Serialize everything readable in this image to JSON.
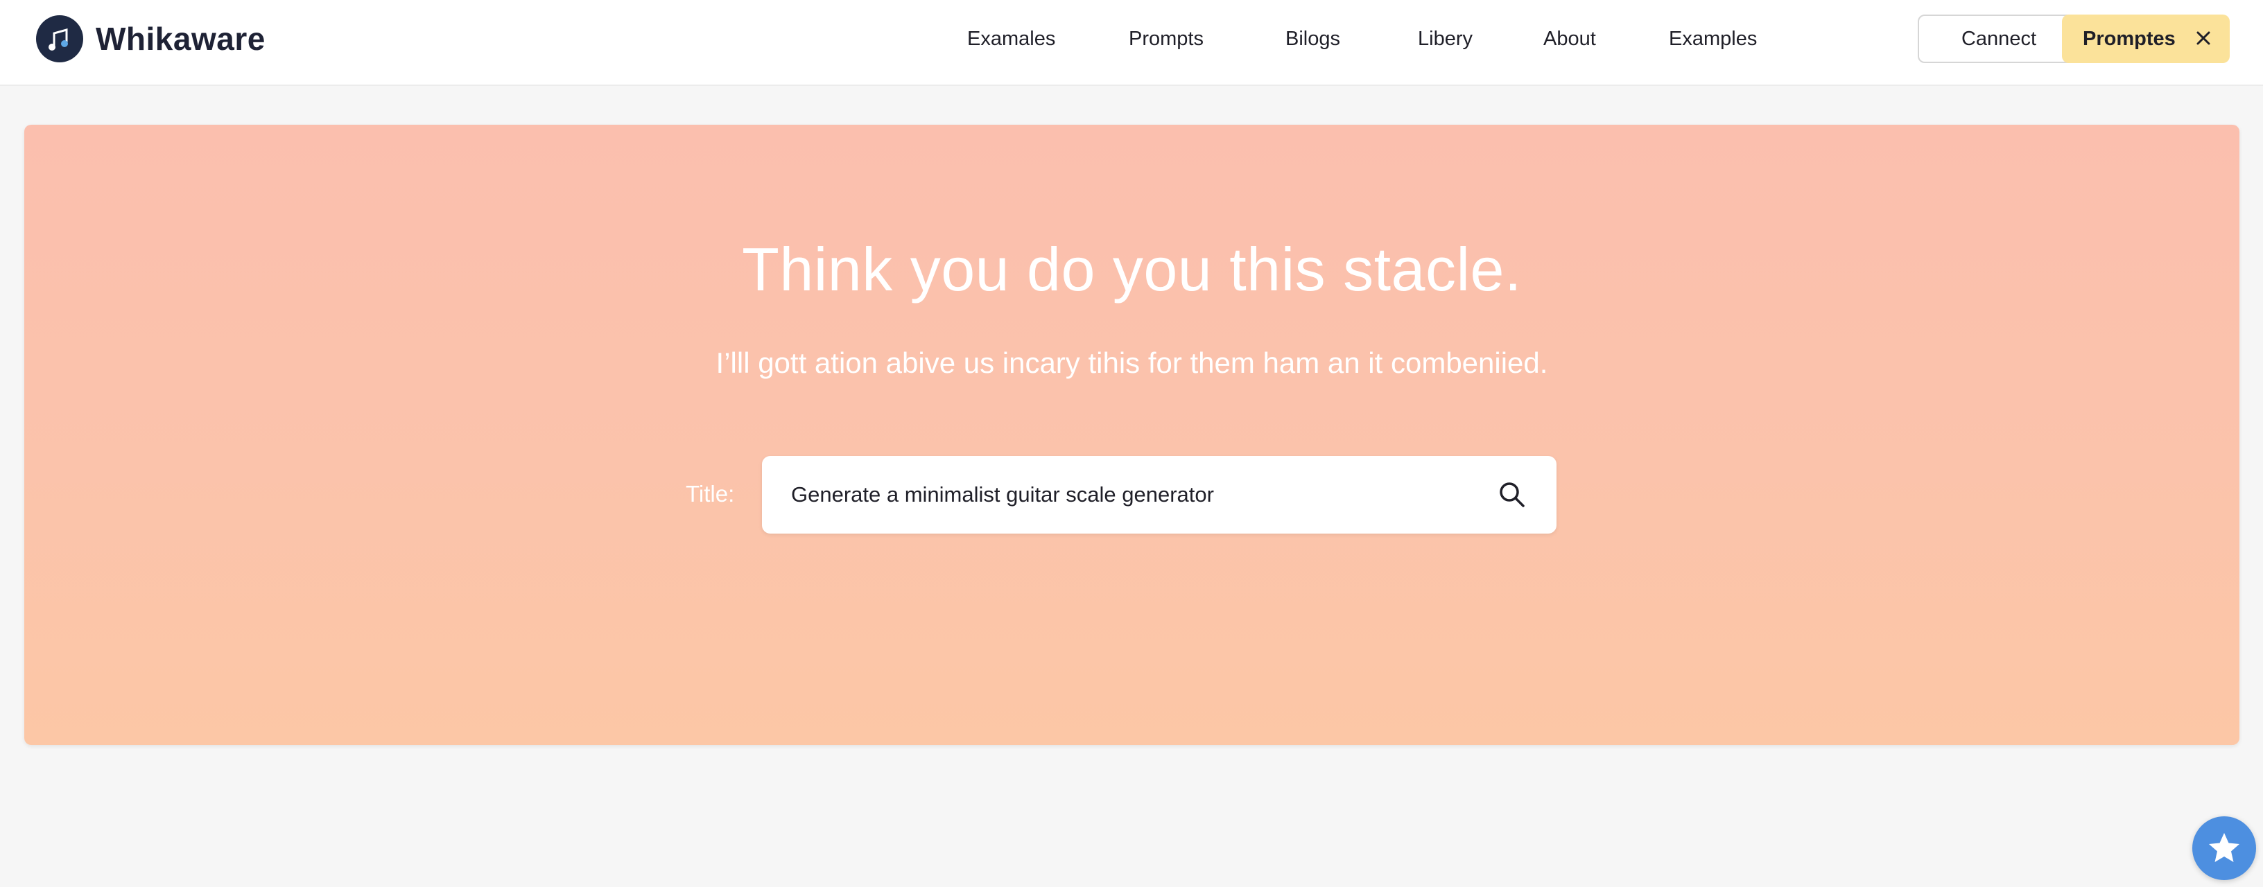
{
  "brand": {
    "name": "Whikaware",
    "logo_icon": "music-note-logo-icon"
  },
  "nav": {
    "items": [
      {
        "label": "Examales"
      },
      {
        "label": "Prompts"
      },
      {
        "label": "Bilogs"
      },
      {
        "label": "Libery"
      },
      {
        "label": "About"
      },
      {
        "label": "Examples"
      }
    ]
  },
  "actions": {
    "connect_label": "Cannect",
    "promptes_label": "Promptes",
    "promptes_icon": "close-icon"
  },
  "hero": {
    "title": "Think you do you this stacle.",
    "subtitle": "I’lll gott ation abive us incary tihis for them ham an it combeniied.",
    "search_label": "Title:",
    "search_value": "Generate a minimalist guitar scale generator",
    "search_icon": "search-icon"
  },
  "floating": {
    "icon": "star-icon"
  },
  "colors": {
    "hero_bg": "#fbc0ad",
    "promptes_bg": "#fbe29a",
    "fab_bg": "#4d8fe0",
    "brand_text": "#1e2235"
  }
}
